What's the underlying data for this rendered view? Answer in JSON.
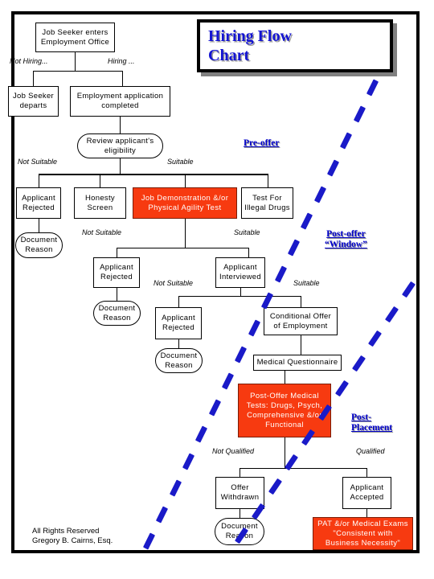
{
  "document": {
    "title_line1": "Hiring Flow",
    "title_line2": "Chart",
    "credit_line1": "All Rights Reserved",
    "credit_line2": "Gregory B. Cairns, Esq."
  },
  "colors": {
    "title_blue": "#1414D2",
    "phase_blue": "#0000CC",
    "dash_blue": "#1A1AC8",
    "highlight_red": "#F73A10",
    "frame_black": "#000000",
    "shadow_gray": "#808080"
  },
  "phase_labels": [
    {
      "id": "pre-offer",
      "text": "Pre-offer"
    },
    {
      "id": "post-offer",
      "line1": "Post-offer",
      "line2": "“Window”"
    },
    {
      "id": "post-placement",
      "line1": "Post-",
      "line2": "Placement"
    }
  ],
  "nodes": [
    {
      "id": "job-seeker-enters",
      "line1": "Job Seeker enters",
      "line2": "Employment Office",
      "shape": "rect",
      "fill": "white"
    },
    {
      "id": "job-seeker-departs",
      "line1": "Job Seeker",
      "line2": "departs",
      "shape": "rect",
      "fill": "white"
    },
    {
      "id": "employment-application",
      "line1": "Employment application",
      "line2": "completed",
      "shape": "rect",
      "fill": "white"
    },
    {
      "id": "review-eligibility",
      "line1": "Review applicant's",
      "line2": "eligibility",
      "shape": "rounded",
      "fill": "white"
    },
    {
      "id": "applicant-rejected-1",
      "line1": "Applicant",
      "line2": "Rejected",
      "shape": "rect",
      "fill": "white"
    },
    {
      "id": "honesty-screen",
      "line1": "Honesty",
      "line2": "Screen",
      "shape": "rect",
      "fill": "white"
    },
    {
      "id": "job-demonstration",
      "line1": "Job Demonstration &/or",
      "line2": "Physical Agility Test",
      "shape": "rect",
      "fill": "red"
    },
    {
      "id": "test-illegal-drugs",
      "line1": "Test For",
      "line2": "Illegal Drugs",
      "shape": "rect",
      "fill": "white"
    },
    {
      "id": "document-reason-1",
      "line1": "Document",
      "line2": "Reason",
      "shape": "rounded",
      "fill": "white"
    },
    {
      "id": "applicant-rejected-2",
      "line1": "Applicant",
      "line2": "Rejected",
      "shape": "rect",
      "fill": "white"
    },
    {
      "id": "applicant-interviewed",
      "line1": "Applicant",
      "line2": "Interviewed",
      "shape": "rect",
      "fill": "white"
    },
    {
      "id": "document-reason-2",
      "line1": "Document",
      "line2": "Reason",
      "shape": "rounded",
      "fill": "white"
    },
    {
      "id": "applicant-rejected-3",
      "line1": "Applicant",
      "line2": "Rejected",
      "shape": "rect",
      "fill": "white"
    },
    {
      "id": "conditional-offer",
      "line1": "Conditional Offer",
      "line2": "of Employment",
      "shape": "rect",
      "fill": "white"
    },
    {
      "id": "document-reason-3",
      "line1": "Document",
      "line2": "Reason",
      "shape": "rounded",
      "fill": "white"
    },
    {
      "id": "medical-questionnaire",
      "line1": "Medical Questionnaire",
      "line2": "",
      "shape": "rect",
      "fill": "white"
    },
    {
      "id": "post-offer-medical",
      "line1": "Post-Offer Medical",
      "line2": "Tests: Drugs, Psych,",
      "line3": "Comprehensive &/or",
      "line4": "Functional",
      "shape": "rect",
      "fill": "red"
    },
    {
      "id": "offer-withdrawn",
      "line1": "Offer",
      "line2": "Withdrawn",
      "shape": "rect",
      "fill": "white"
    },
    {
      "id": "applicant-accepted",
      "line1": "Applicant",
      "line2": "Accepted",
      "shape": "rect",
      "fill": "white"
    },
    {
      "id": "document-reason-4",
      "line1": "Document",
      "line2": "Reason",
      "shape": "rounded",
      "fill": "white"
    },
    {
      "id": "pat-medical-exams",
      "line1": "PAT &/or Medical Exams",
      "line2": "\"Consistent with",
      "line3": "Business Necessity\"",
      "shape": "rect",
      "fill": "red"
    }
  ],
  "edge_labels": [
    {
      "id": "not-hiring",
      "text": "Not Hiring..."
    },
    {
      "id": "hiring",
      "text": "Hiring ..."
    },
    {
      "id": "not-suitable-1",
      "text": "Not Suitable"
    },
    {
      "id": "suitable-1",
      "text": "Suitable"
    },
    {
      "id": "not-suitable-2",
      "text": "Not Suitable"
    },
    {
      "id": "suitable-2",
      "text": "Suitable"
    },
    {
      "id": "not-suitable-3",
      "text": "Not Suitable"
    },
    {
      "id": "suitable-3",
      "text": "Suitable"
    },
    {
      "id": "not-qualified",
      "text": "Not Qualified"
    },
    {
      "id": "qualified",
      "text": "Qualified"
    }
  ]
}
